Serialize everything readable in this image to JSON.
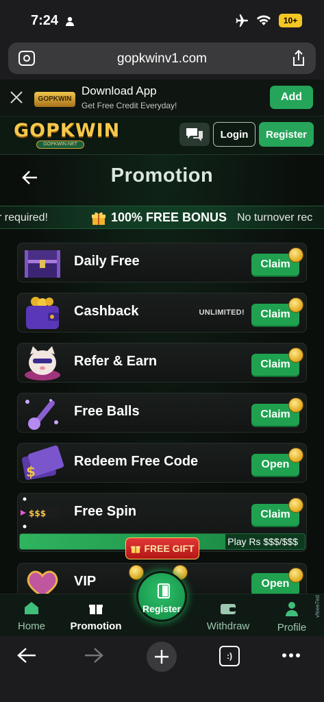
{
  "status": {
    "time": "7:24",
    "battery": "10+"
  },
  "browser": {
    "url": "gopkwinv1.com"
  },
  "download_banner": {
    "title": "Download App",
    "subtitle": "Get Free Credit Everyday!",
    "add_label": "Add",
    "logo_text": "GOPKWIN"
  },
  "header": {
    "logo_text": "GOPKWIN",
    "logo_sub": "GOPKWIN.NET",
    "login_label": "Login",
    "register_label": "Register"
  },
  "page": {
    "title": "Promotion"
  },
  "marquee": {
    "left_text": "r required!",
    "bonus_text": "100% FREE BONUS",
    "right_text": "No turnover rec"
  },
  "promotions": [
    {
      "label": "Daily Free",
      "button": "Claim",
      "icon": "treasure-chest-icon"
    },
    {
      "label": "Cashback",
      "badge": "UNLIMITED!",
      "button": "Claim",
      "icon": "wallet-icon"
    },
    {
      "label": "Refer & Earn",
      "button": "Claim",
      "icon": "cat-mascot-icon"
    },
    {
      "label": "Free Balls",
      "button": "Claim",
      "icon": "ball-icon"
    },
    {
      "label": "Redeem Free Code",
      "button": "Open",
      "icon": "ticket-icon"
    },
    {
      "label": "Free Spin",
      "button": "Claim",
      "icon": "spin-icon",
      "progress_text": "Play Rs $$$/$$$",
      "progress": 0.72,
      "icon_text": "$$$"
    },
    {
      "label": "VIP",
      "button": "Open",
      "icon": "heart-icon"
    }
  ],
  "free_gift": {
    "label": "FREE GIFT"
  },
  "nav": {
    "home": "Home",
    "promotion": "Promotion",
    "register": "Register",
    "withdraw": "Withdraw",
    "profile": "Profile"
  },
  "watermark": "vfeee7ed",
  "colors": {
    "accent": "#1fa14f",
    "gold": "#f4c84c",
    "background": "#0b0f0c"
  }
}
